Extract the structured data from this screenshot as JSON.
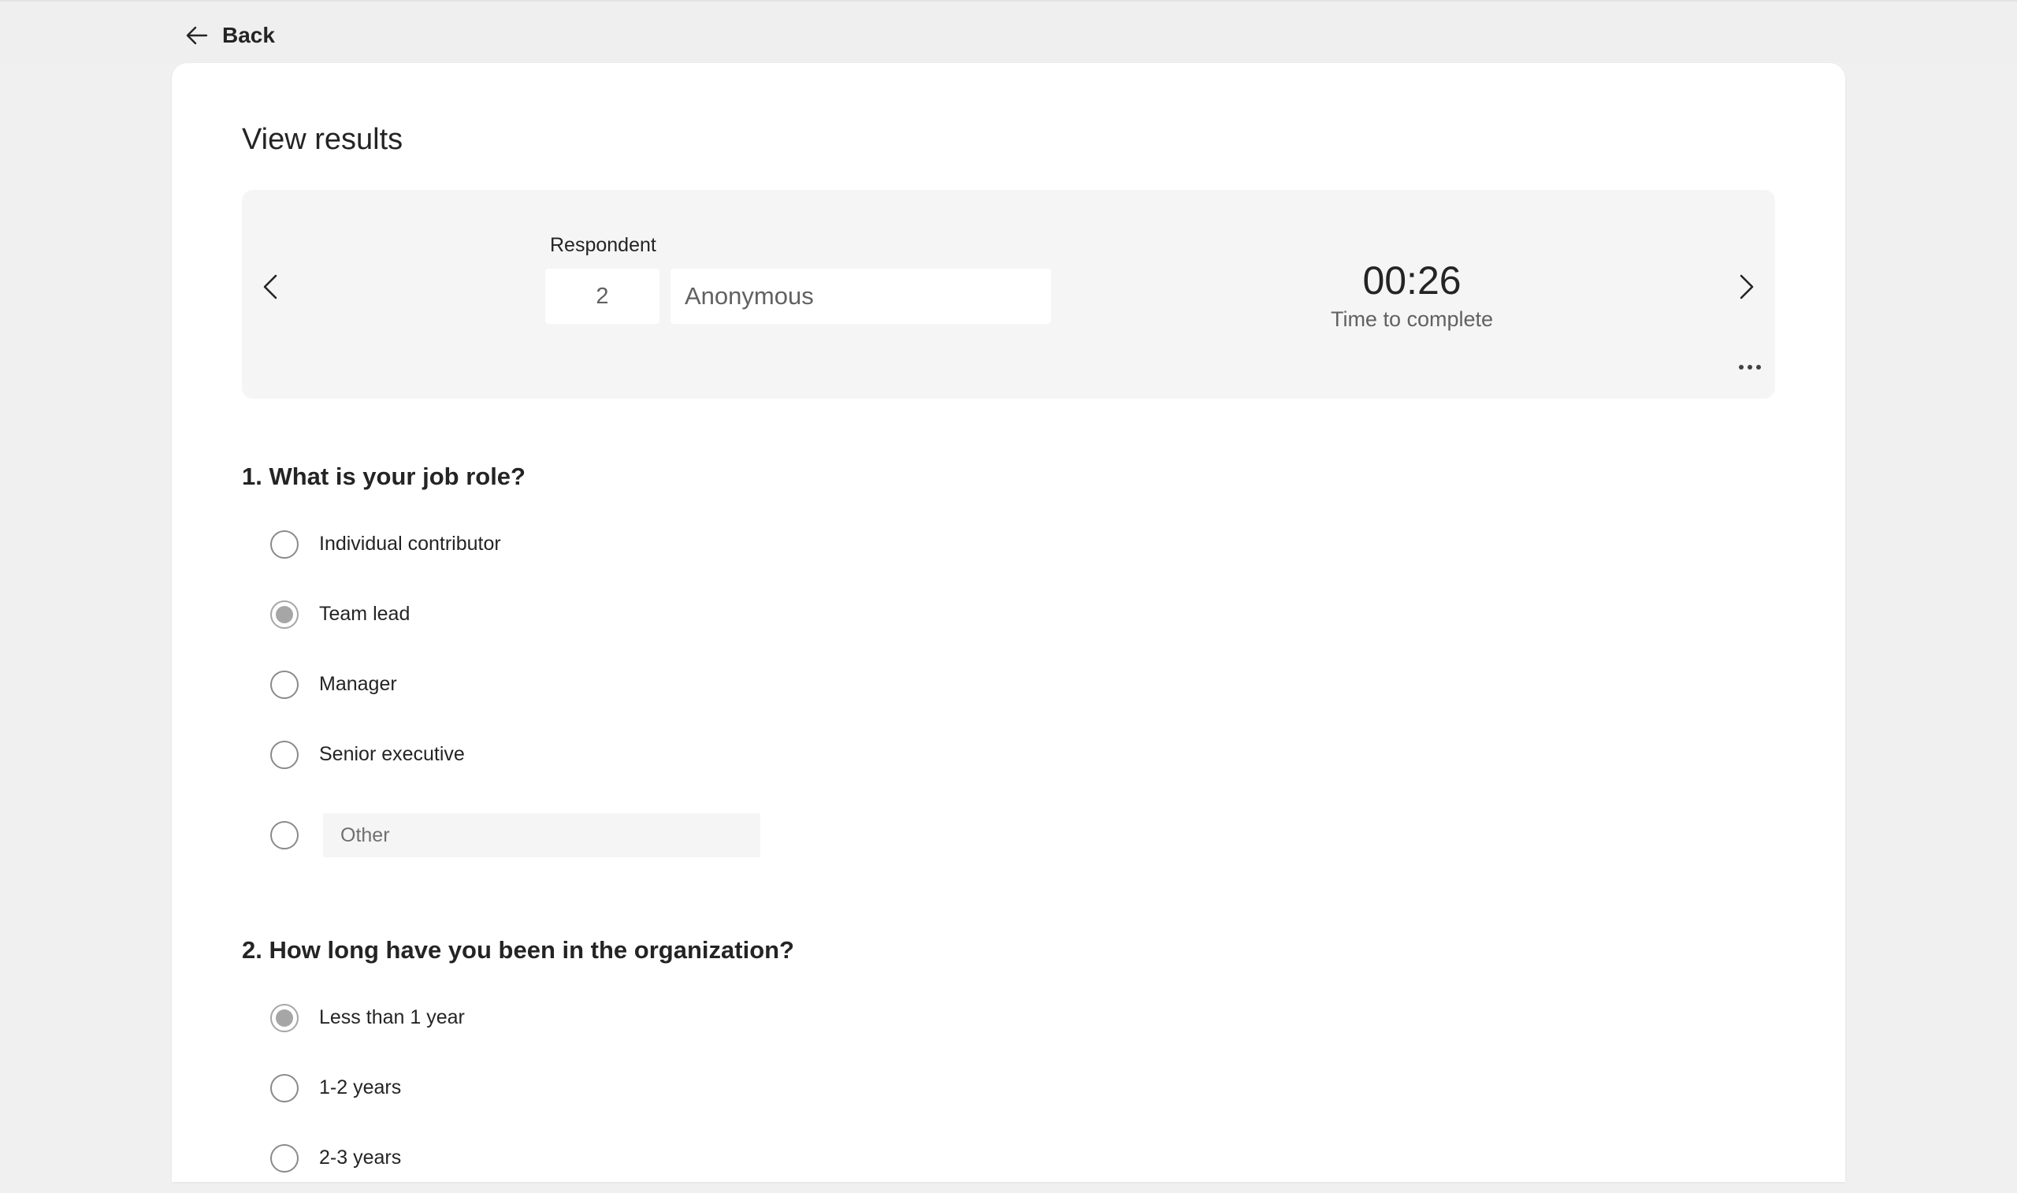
{
  "topbar": {
    "back_label": "Back"
  },
  "page": {
    "title": "View results"
  },
  "respondent": {
    "label": "Respondent",
    "number": "2",
    "name": "Anonymous",
    "time_value": "00:26",
    "time_label": "Time to complete"
  },
  "questions": [
    {
      "title": "1. What is your job role?",
      "options": [
        {
          "label": "Individual contributor",
          "selected": false
        },
        {
          "label": "Team lead",
          "selected": true
        },
        {
          "label": "Manager",
          "selected": false
        },
        {
          "label": "Senior executive",
          "selected": false
        }
      ],
      "other_placeholder": "Other"
    },
    {
      "title": "2. How long have you been in the organization?",
      "options": [
        {
          "label": "Less than 1 year",
          "selected": true
        },
        {
          "label": "1-2 years",
          "selected": false
        },
        {
          "label": "2-3 years",
          "selected": false
        }
      ]
    }
  ],
  "icons": {
    "back": "arrow-left-icon",
    "prev": "chevron-left-icon",
    "next": "chevron-right-icon",
    "more": "more-horizontal-icon"
  },
  "colors": {
    "page_bg": "#f0f0f0",
    "card_bg": "#ffffff",
    "panel_bg": "#f5f5f5",
    "selected_radio": "#a6a6a6"
  }
}
